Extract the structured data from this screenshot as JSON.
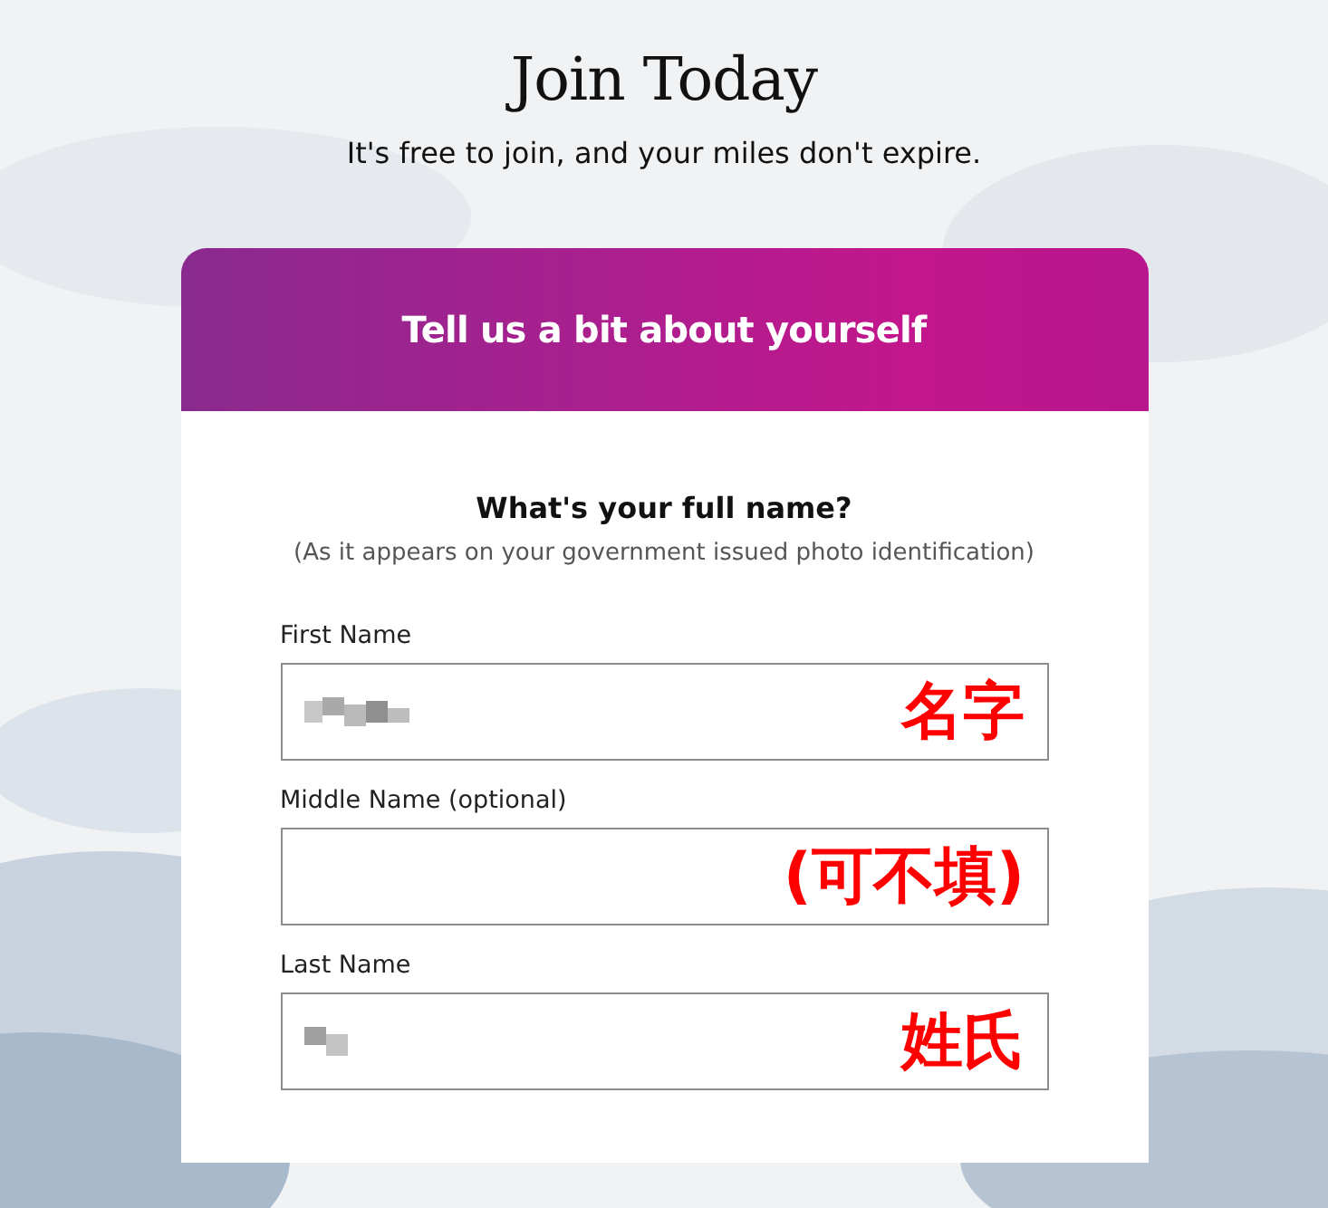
{
  "page": {
    "title": "Join Today",
    "subtitle": "It's free to join, and your miles don't expire."
  },
  "card": {
    "header": "Tell us a bit about yourself",
    "question": "What's your full name?",
    "hint": "(As it appears on your government issued photo identification)",
    "fields": [
      {
        "label": "First Name",
        "redacted": true,
        "annotation": "名字"
      },
      {
        "label": "Middle Name (optional)",
        "redacted": false,
        "annotation": "(可不填)"
      },
      {
        "label": "Last Name",
        "redacted": true,
        "annotation": "姓氏"
      }
    ]
  }
}
